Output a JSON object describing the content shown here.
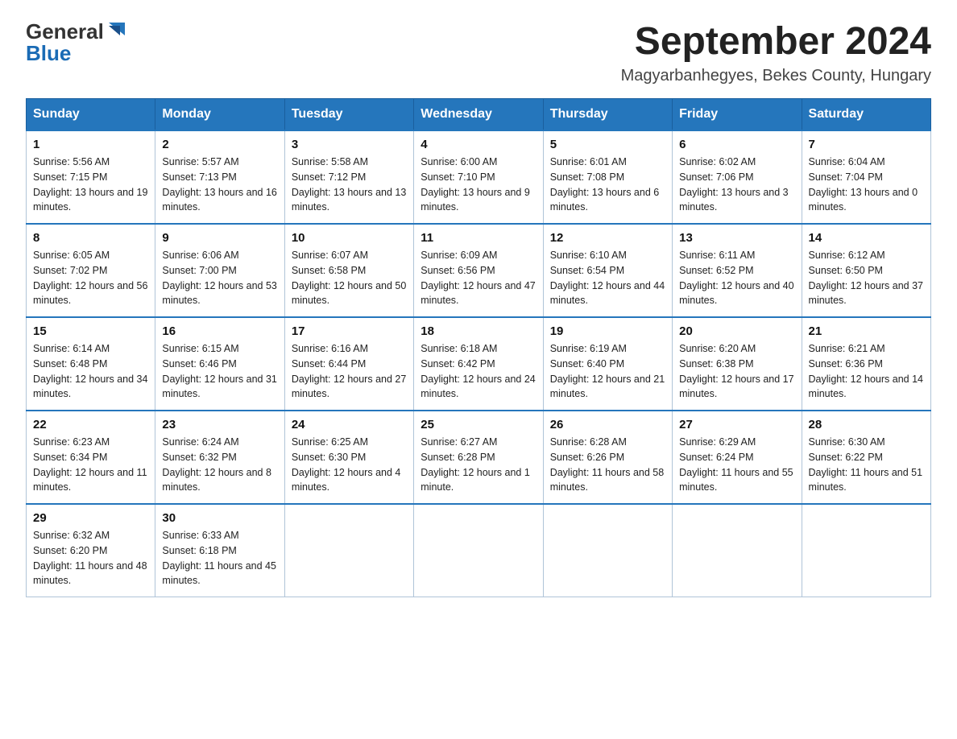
{
  "header": {
    "logo_general": "General",
    "logo_blue": "Blue",
    "title": "September 2024",
    "subtitle": "Magyarbanhegyes, Bekes County, Hungary"
  },
  "days_of_week": [
    "Sunday",
    "Monday",
    "Tuesday",
    "Wednesday",
    "Thursday",
    "Friday",
    "Saturday"
  ],
  "weeks": [
    [
      {
        "day": "1",
        "sunrise": "5:56 AM",
        "sunset": "7:15 PM",
        "daylight": "13 hours and 19 minutes."
      },
      {
        "day": "2",
        "sunrise": "5:57 AM",
        "sunset": "7:13 PM",
        "daylight": "13 hours and 16 minutes."
      },
      {
        "day": "3",
        "sunrise": "5:58 AM",
        "sunset": "7:12 PM",
        "daylight": "13 hours and 13 minutes."
      },
      {
        "day": "4",
        "sunrise": "6:00 AM",
        "sunset": "7:10 PM",
        "daylight": "13 hours and 9 minutes."
      },
      {
        "day": "5",
        "sunrise": "6:01 AM",
        "sunset": "7:08 PM",
        "daylight": "13 hours and 6 minutes."
      },
      {
        "day": "6",
        "sunrise": "6:02 AM",
        "sunset": "7:06 PM",
        "daylight": "13 hours and 3 minutes."
      },
      {
        "day": "7",
        "sunrise": "6:04 AM",
        "sunset": "7:04 PM",
        "daylight": "13 hours and 0 minutes."
      }
    ],
    [
      {
        "day": "8",
        "sunrise": "6:05 AM",
        "sunset": "7:02 PM",
        "daylight": "12 hours and 56 minutes."
      },
      {
        "day": "9",
        "sunrise": "6:06 AM",
        "sunset": "7:00 PM",
        "daylight": "12 hours and 53 minutes."
      },
      {
        "day": "10",
        "sunrise": "6:07 AM",
        "sunset": "6:58 PM",
        "daylight": "12 hours and 50 minutes."
      },
      {
        "day": "11",
        "sunrise": "6:09 AM",
        "sunset": "6:56 PM",
        "daylight": "12 hours and 47 minutes."
      },
      {
        "day": "12",
        "sunrise": "6:10 AM",
        "sunset": "6:54 PM",
        "daylight": "12 hours and 44 minutes."
      },
      {
        "day": "13",
        "sunrise": "6:11 AM",
        "sunset": "6:52 PM",
        "daylight": "12 hours and 40 minutes."
      },
      {
        "day": "14",
        "sunrise": "6:12 AM",
        "sunset": "6:50 PM",
        "daylight": "12 hours and 37 minutes."
      }
    ],
    [
      {
        "day": "15",
        "sunrise": "6:14 AM",
        "sunset": "6:48 PM",
        "daylight": "12 hours and 34 minutes."
      },
      {
        "day": "16",
        "sunrise": "6:15 AM",
        "sunset": "6:46 PM",
        "daylight": "12 hours and 31 minutes."
      },
      {
        "day": "17",
        "sunrise": "6:16 AM",
        "sunset": "6:44 PM",
        "daylight": "12 hours and 27 minutes."
      },
      {
        "day": "18",
        "sunrise": "6:18 AM",
        "sunset": "6:42 PM",
        "daylight": "12 hours and 24 minutes."
      },
      {
        "day": "19",
        "sunrise": "6:19 AM",
        "sunset": "6:40 PM",
        "daylight": "12 hours and 21 minutes."
      },
      {
        "day": "20",
        "sunrise": "6:20 AM",
        "sunset": "6:38 PM",
        "daylight": "12 hours and 17 minutes."
      },
      {
        "day": "21",
        "sunrise": "6:21 AM",
        "sunset": "6:36 PM",
        "daylight": "12 hours and 14 minutes."
      }
    ],
    [
      {
        "day": "22",
        "sunrise": "6:23 AM",
        "sunset": "6:34 PM",
        "daylight": "12 hours and 11 minutes."
      },
      {
        "day": "23",
        "sunrise": "6:24 AM",
        "sunset": "6:32 PM",
        "daylight": "12 hours and 8 minutes."
      },
      {
        "day": "24",
        "sunrise": "6:25 AM",
        "sunset": "6:30 PM",
        "daylight": "12 hours and 4 minutes."
      },
      {
        "day": "25",
        "sunrise": "6:27 AM",
        "sunset": "6:28 PM",
        "daylight": "12 hours and 1 minute."
      },
      {
        "day": "26",
        "sunrise": "6:28 AM",
        "sunset": "6:26 PM",
        "daylight": "11 hours and 58 minutes."
      },
      {
        "day": "27",
        "sunrise": "6:29 AM",
        "sunset": "6:24 PM",
        "daylight": "11 hours and 55 minutes."
      },
      {
        "day": "28",
        "sunrise": "6:30 AM",
        "sunset": "6:22 PM",
        "daylight": "11 hours and 51 minutes."
      }
    ],
    [
      {
        "day": "29",
        "sunrise": "6:32 AM",
        "sunset": "6:20 PM",
        "daylight": "11 hours and 48 minutes."
      },
      {
        "day": "30",
        "sunrise": "6:33 AM",
        "sunset": "6:18 PM",
        "daylight": "11 hours and 45 minutes."
      },
      null,
      null,
      null,
      null,
      null
    ]
  ],
  "labels": {
    "sunrise": "Sunrise: ",
    "sunset": "Sunset: ",
    "daylight": "Daylight: "
  }
}
